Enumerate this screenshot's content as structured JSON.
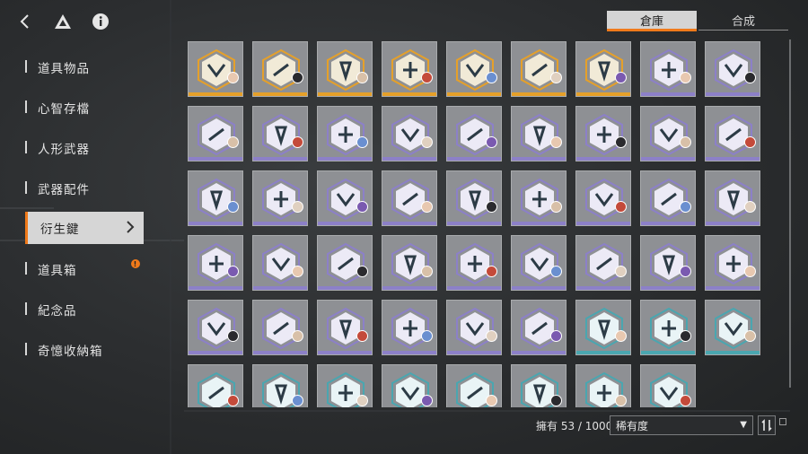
{
  "topbar": {
    "icons": [
      "back-arrow-icon",
      "triangle-logo-icon",
      "info-icon"
    ]
  },
  "tabs": [
    {
      "label": "倉庫",
      "active": true
    },
    {
      "label": "合成",
      "active": false
    }
  ],
  "sidebar": {
    "items": [
      {
        "label": "道具物品",
        "active": false
      },
      {
        "label": "心智存檔",
        "active": false
      },
      {
        "label": "人形武器",
        "active": false
      },
      {
        "label": "武器配件",
        "active": false
      },
      {
        "label": "衍生鍵",
        "active": true
      },
      {
        "label": "道具箱",
        "active": false,
        "badge": "!"
      },
      {
        "label": "紀念品",
        "active": false
      },
      {
        "label": "奇憶收納箱",
        "active": false
      }
    ]
  },
  "inventory": {
    "owned_label": "擁有 53 / 1000",
    "sort_label": "稀有度",
    "colors": {
      "gold": "#e5a02a",
      "purple": "#8c80c8",
      "teal": "#4aa6b0",
      "accent": "#f07a1a"
    },
    "rows": [
      [
        "gold",
        "gold",
        "gold",
        "gold",
        "gold",
        "gold",
        "gold",
        "purple",
        "purple"
      ],
      [
        "purple",
        "purple",
        "purple",
        "purple",
        "purple",
        "purple",
        "purple",
        "purple",
        "purple"
      ],
      [
        "purple",
        "purple",
        "purple",
        "purple",
        "purple",
        "purple",
        "purple",
        "purple",
        "purple"
      ],
      [
        "purple",
        "purple",
        "purple",
        "purple",
        "purple",
        "purple",
        "purple",
        "purple",
        "purple"
      ],
      [
        "purple",
        "purple",
        "purple",
        "purple",
        "purple",
        "purple",
        "teal",
        "teal",
        "teal"
      ],
      [
        "teal",
        "teal",
        "teal",
        "teal",
        "teal",
        "teal",
        "teal",
        "teal"
      ]
    ]
  }
}
